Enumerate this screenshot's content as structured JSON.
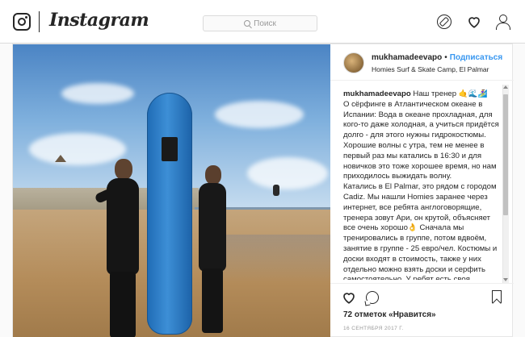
{
  "nav": {
    "logo_text": "Instagram",
    "search_placeholder": "Поиск",
    "icons": [
      "instagram-icon",
      "explore-compass-icon",
      "activity-heart-icon",
      "profile-person-icon"
    ]
  },
  "post": {
    "username": "mukhamadeevapo",
    "follow_label": "Подписаться",
    "separator": "•",
    "location": "Homies Surf & Skate Camp, El Palmar",
    "caption_user": "mukhamadeevapo",
    "caption_lines": [
      "Наш тренер 🤙🌊🏄‍♀️",
      "О сёрфинге в Атлантическом океане в Испании: Вода в океане прохладная, для кого-то даже холодная, а учиться придётся долго - для этого нужны гидрокостюмы. Хорошие волны с утра, тем не менее в первый раз мы катались в 16:30 и для новичков это тоже хорошее время, но нам приходилось выжидать волну.",
      "Катались в El Palmar, это рядом с городом Cadiz. Мы нашли Homies заранее через интернет, все ребята англоговорящие, тренера зовут Ари, он крутой, объясняет все очень хорошо👌 Сначала мы тренировались в группе, потом вдвоём, занятие в группе - 25 евро/чел. Костюмы и доски входят в стоимость, также у них отдельно можно взять доски и серфить самостоятельно. У ребят есть своя"
    ],
    "likes_label": "72 отметок «Нравится»",
    "date_label": "16 СЕНТЯБРЯ 2017 Г."
  },
  "colors": {
    "link": "#3897f0",
    "text": "#262626",
    "border": "#dbdbdb",
    "background": "#fafafa"
  }
}
